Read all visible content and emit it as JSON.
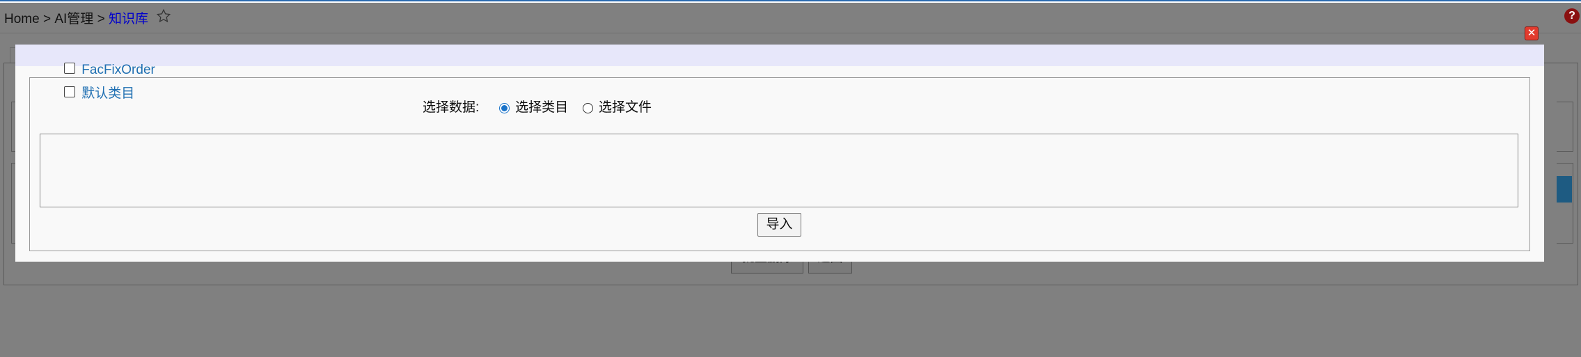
{
  "breadcrumb": {
    "home": "Home",
    "sep1": ">",
    "parent": "AI管理",
    "sep2": ">",
    "current": "知识库",
    "star_icon": "☆"
  },
  "help_icon": "?",
  "background_page": {
    "batch_delete_label": "批量删除",
    "back_label": "返回"
  },
  "dialog": {
    "close_icon": "✕",
    "select_data_label": "选择数据:",
    "options": [
      {
        "label": "选择类目",
        "checked": true
      },
      {
        "label": "选择文件",
        "checked": false
      }
    ],
    "categories": [
      {
        "label": "FacFixOrder",
        "checked": false
      },
      {
        "label": "默认类目",
        "checked": false
      }
    ],
    "import_label": "导入"
  },
  "colors": {
    "overlay": "#808080",
    "modal_header": "#e7e7fa",
    "link": "#1f6fb2",
    "radio_accent": "#1a73c9",
    "close": "#e23b2e"
  }
}
